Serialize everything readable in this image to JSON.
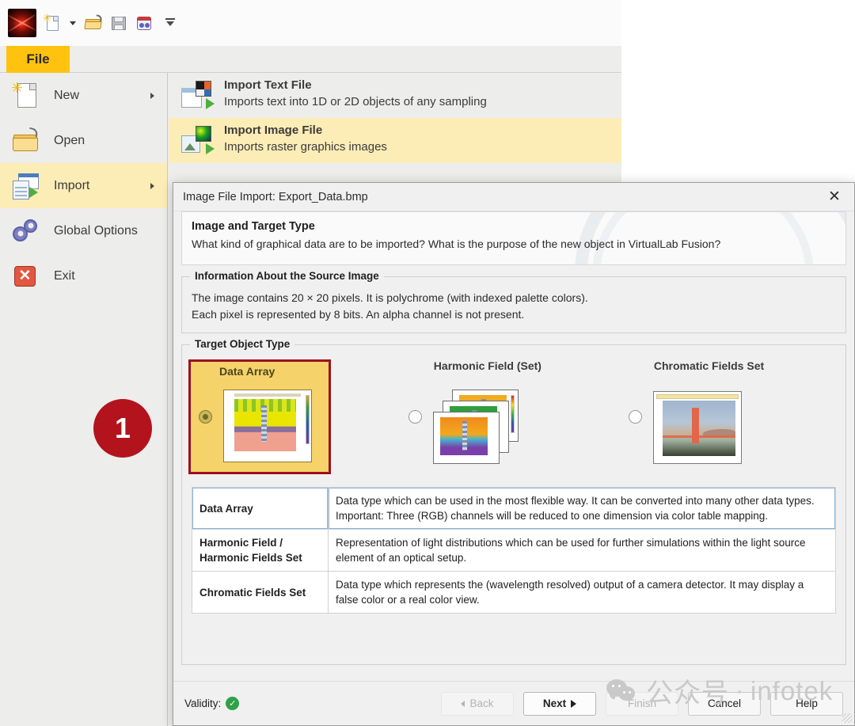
{
  "app": {
    "quick_toolbar": {
      "logo_name": "virtuallab-logo",
      "items": [
        {
          "name": "new-document-icon",
          "label": "New"
        },
        {
          "name": "new-dropdown-caret",
          "label": ""
        },
        {
          "name": "open-folder-icon",
          "label": "Open"
        },
        {
          "name": "save-icon",
          "label": "Save"
        },
        {
          "name": "batch-run-icon",
          "label": "Parameter Run"
        },
        {
          "name": "customize-toolbar-icon",
          "label": ""
        }
      ]
    },
    "ribbon": {
      "file_tab": "File"
    }
  },
  "backstage": {
    "menu": [
      {
        "label": "New",
        "icon": "new-document-icon",
        "has_submenu": true,
        "active": false
      },
      {
        "label": "Open",
        "icon": "open-folder-icon",
        "has_submenu": false,
        "active": false
      },
      {
        "label": "Import",
        "icon": "import-icon",
        "has_submenu": true,
        "active": true
      },
      {
        "label": "Global Options",
        "icon": "gears-icon",
        "has_submenu": false,
        "active": false
      },
      {
        "label": "Exit",
        "icon": "exit-icon",
        "has_submenu": false,
        "active": false
      }
    ],
    "import_options": [
      {
        "title": "Import Text File",
        "description": "Imports text into 1D or 2D objects of any sampling",
        "icon": "import-text-file-icon",
        "highlighted": false
      },
      {
        "title": "Import Image File",
        "description": "Imports raster graphics images",
        "icon": "import-image-file-icon",
        "highlighted": true
      }
    ]
  },
  "annotation": {
    "step_number": "1",
    "color": "#b3131d"
  },
  "dialog": {
    "title": "Image File Import: Export_Data.bmp",
    "close_label": "✕",
    "banner": {
      "heading": "Image and Target Type",
      "subtext": "What kind of graphical data are to be imported? What is the purpose of the new object in VirtualLab Fusion?"
    },
    "source_info": {
      "legend": "Information About the Source Image",
      "line1": "The image contains 20 × 20 pixels. It is polychrome (with indexed palette colors).",
      "line2": "Each pixel is represented by 8 bits. An alpha channel is not present."
    },
    "target_object_type": {
      "legend": "Target Object Type",
      "options": [
        {
          "label": "Data Array",
          "selected": true,
          "thumbnail": "data-array-thumbnail"
        },
        {
          "label": "Harmonic Field (Set)",
          "selected": false,
          "thumbnail": "harmonic-field-set-thumbnail"
        },
        {
          "label": "Chromatic Fields Set",
          "selected": false,
          "thumbnail": "chromatic-fields-set-thumbnail"
        }
      ]
    },
    "description_table": {
      "rows": [
        {
          "key": "Data Array",
          "value": "Data type which can be used in the most flexible way. It can be converted into many other data types. Important: Three (RGB) channels will be reduced to one dimension via color table mapping.",
          "highlighted": true
        },
        {
          "key": "Harmonic Field / Harmonic Fields Set",
          "value": "Representation of light distributions which can be used for further simulations within the light source element of an optical setup.",
          "highlighted": false
        },
        {
          "key": "Chromatic Fields Set",
          "value": "Data type which represents the (wavelength resolved) output of a camera detector. It may display a false color or a real color view.",
          "highlighted": false
        }
      ]
    },
    "footer": {
      "validity_label": "Validity:",
      "validity_state": "valid",
      "buttons": [
        {
          "label": "Back",
          "enabled": false,
          "name": "back-button"
        },
        {
          "label": "Next",
          "enabled": true,
          "name": "next-button"
        },
        {
          "label": "Finish",
          "enabled": false,
          "name": "finish-button"
        },
        {
          "label": "Cancel",
          "enabled": true,
          "name": "cancel-button"
        },
        {
          "label": "Help",
          "enabled": true,
          "name": "help-button"
        }
      ]
    }
  },
  "watermark": {
    "cn": "公众号",
    "dot": "·",
    "en": "infotek"
  }
}
